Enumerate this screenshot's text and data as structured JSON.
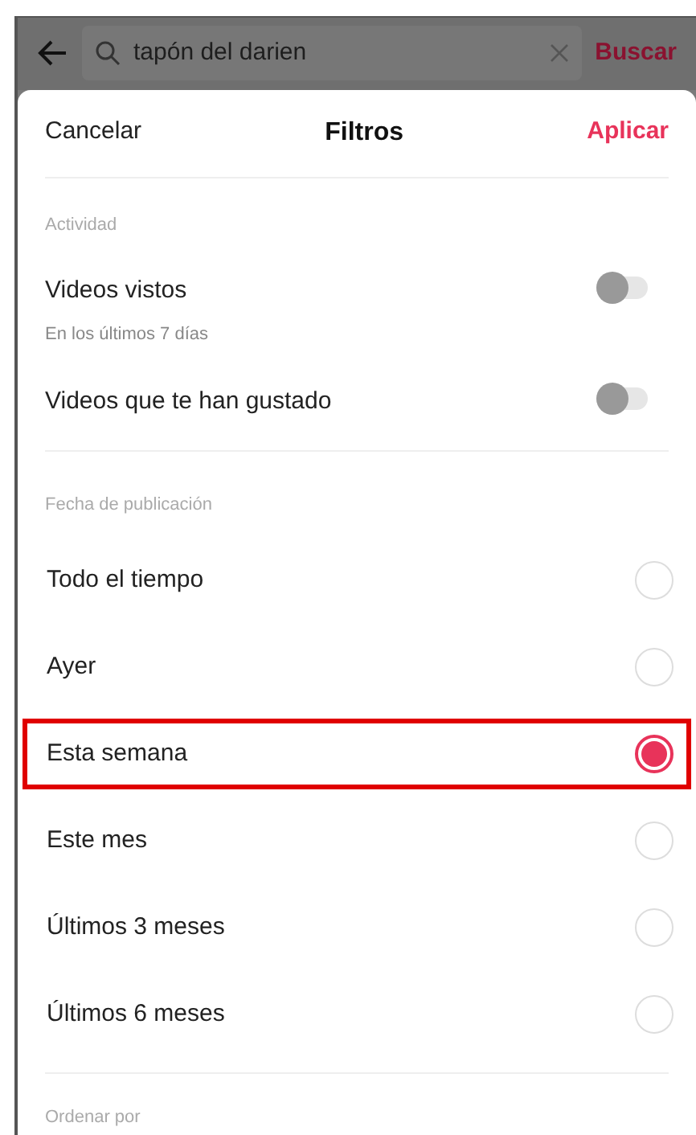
{
  "search_bar": {
    "query": "tapón del darien",
    "action": "Buscar"
  },
  "sheet": {
    "cancel": "Cancelar",
    "title": "Filtros",
    "apply": "Aplicar"
  },
  "activity": {
    "heading": "Actividad",
    "items": [
      {
        "label": "Videos vistos",
        "subtitle": "En los últimos 7 días",
        "on": false
      },
      {
        "label": "Videos que te han gustado",
        "on": false
      }
    ]
  },
  "date": {
    "heading": "Fecha de publicación",
    "options": [
      {
        "label": "Todo el tiempo",
        "selected": false,
        "highlighted": false
      },
      {
        "label": "Ayer",
        "selected": false,
        "highlighted": false
      },
      {
        "label": "Esta semana",
        "selected": true,
        "highlighted": true
      },
      {
        "label": "Este mes",
        "selected": false,
        "highlighted": false
      },
      {
        "label": "Últimos 3 meses",
        "selected": false,
        "highlighted": false
      },
      {
        "label": "Últimos 6 meses",
        "selected": false,
        "highlighted": false
      }
    ]
  },
  "sort": {
    "heading": "Ordenar por"
  }
}
